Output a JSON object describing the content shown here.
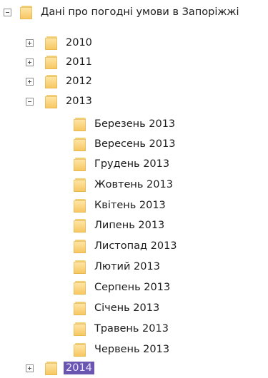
{
  "tree": {
    "root": {
      "label": "Дані про погодні умови в Запоріжжі"
    },
    "years": [
      {
        "label": "2010"
      },
      {
        "label": "2011"
      },
      {
        "label": "2012"
      },
      {
        "label": "2013"
      }
    ],
    "months_2013": [
      "Березень 2013",
      "Вересень 2013",
      "Грудень 2013",
      "Жовтень 2013",
      "Квітень 2013",
      "Липень 2013",
      "Листопад 2013",
      "Лютий 2013",
      "Серпень 2013",
      "Січень 2013",
      "Травень 2013",
      "Червень 2013"
    ],
    "last_year": {
      "label": "2014"
    }
  },
  "icons": {
    "folder": "folder-icon",
    "expand": "plus-box-icon",
    "collapse": "minus-box-icon"
  },
  "colors": {
    "folder": "#f6c65f",
    "selection": "#6a55b1"
  }
}
